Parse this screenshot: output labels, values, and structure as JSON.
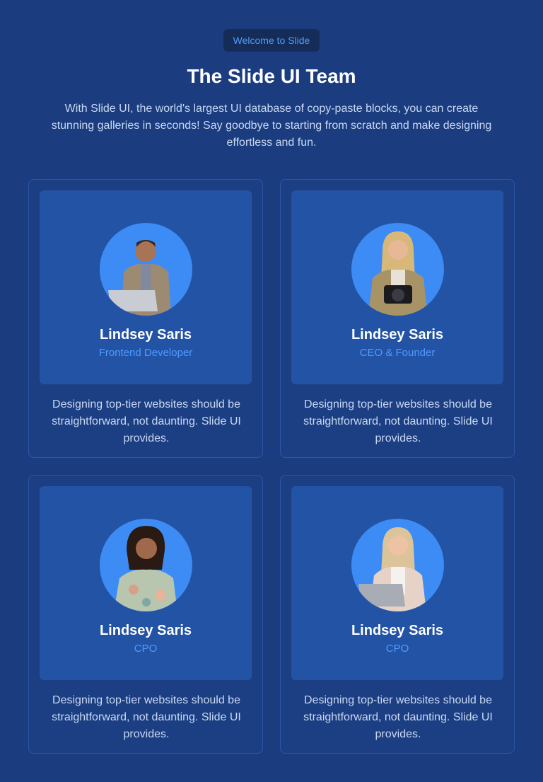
{
  "header": {
    "badge": "Welcome to Slide",
    "title": "The Slide UI Team",
    "subtitle": "With Slide UI, the world's largest UI database of copy-paste blocks, you can create stunning galleries in seconds! Say goodbye to starting from scratch and make designing effortless and fun."
  },
  "colors": {
    "background": "#1b3d7f",
    "card_panel": "#2353a5",
    "accent": "#4f9bff",
    "avatar_circle": "#3d8cf5"
  },
  "team": [
    {
      "name": "Lindsey Saris",
      "role": "Frontend Developer",
      "description": "Designing top-tier websites should be straightforward, not daunting. Slide UI provides.",
      "photo": "man-with-laptop-photo"
    },
    {
      "name": "Lindsey Saris",
      "role": "CEO & Founder",
      "description": "Designing top-tier websites should be straightforward, not daunting. Slide UI provides.",
      "photo": "woman-with-camera-photo"
    },
    {
      "name": "Lindsey Saris",
      "role": "CPO",
      "description": "Designing top-tier websites should be straightforward, not daunting. Slide UI provides.",
      "photo": "woman-curly-hair-photo"
    },
    {
      "name": "Lindsey Saris",
      "role": "CPO",
      "description": "Designing top-tier websites should be straightforward, not daunting. Slide UI provides.",
      "photo": "woman-with-tablet-photo"
    }
  ]
}
